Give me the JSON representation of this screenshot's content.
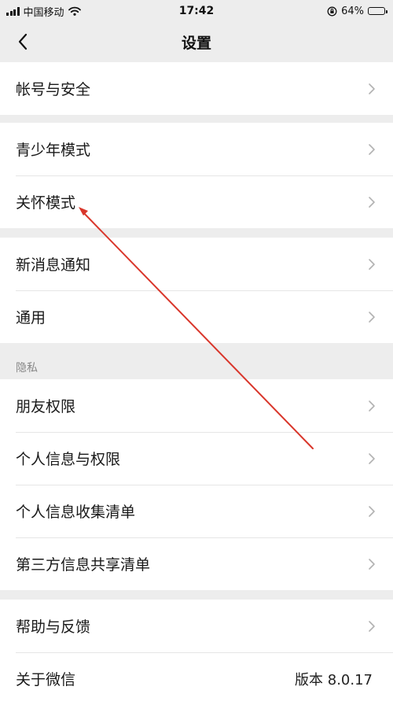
{
  "status_bar": {
    "carrier": "中国移动",
    "time": "17:42",
    "battery": "64%",
    "battery_level": 0.64
  },
  "nav": {
    "title": "设置",
    "back_icon": "chevron-left-icon"
  },
  "groups": [
    {
      "items": [
        {
          "label": "帐号与安全"
        }
      ]
    },
    {
      "items": [
        {
          "label": "青少年模式"
        },
        {
          "label": "关怀模式"
        }
      ]
    },
    {
      "items": [
        {
          "label": "新消息通知"
        },
        {
          "label": "通用"
        }
      ]
    },
    {
      "header": "隐私",
      "items": [
        {
          "label": "朋友权限"
        },
        {
          "label": "个人信息与权限"
        },
        {
          "label": "个人信息收集清单"
        },
        {
          "label": "第三方信息共享清单"
        }
      ]
    },
    {
      "items": [
        {
          "label": "帮助与反馈"
        },
        {
          "label": "关于微信",
          "value": "版本 8.0.17"
        }
      ]
    }
  ],
  "colors": {
    "background": "#ededed",
    "card": "#ffffff",
    "annotation_arrow": "#d9362b"
  }
}
